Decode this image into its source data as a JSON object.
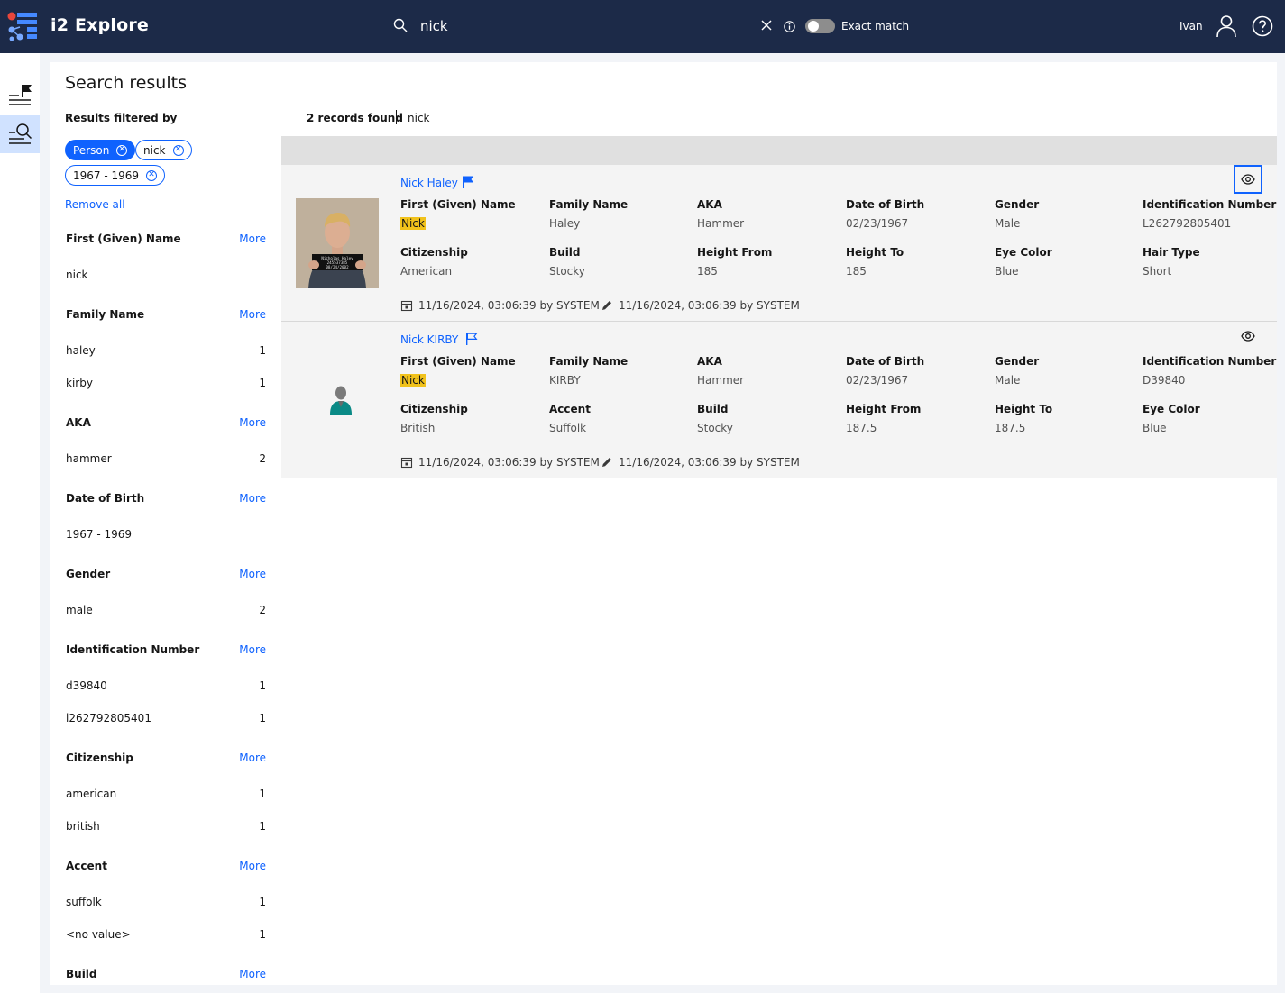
{
  "header": {
    "app_title": "i2 Explore",
    "search_value": "nick",
    "toggle_label": "Exact match",
    "user_name": "Ivan"
  },
  "main": {
    "title": "Search results",
    "records_found": "2 records found",
    "search_term": "nick"
  },
  "filters": {
    "heading": "Results filtered by",
    "chips": [
      "Person",
      "nick",
      "1967 - 1969"
    ],
    "remove_all": "Remove all",
    "more_label": "More",
    "facets": [
      {
        "title": "First (Given) Name",
        "rows": [
          {
            "label": "nick",
            "count": ""
          }
        ]
      },
      {
        "title": "Family Name",
        "rows": [
          {
            "label": "haley",
            "count": "1"
          },
          {
            "label": "kirby",
            "count": "1"
          }
        ]
      },
      {
        "title": "AKA",
        "rows": [
          {
            "label": "hammer",
            "count": "2"
          }
        ]
      },
      {
        "title": "Date of Birth",
        "rows": [
          {
            "label": "1967 - 1969",
            "count": ""
          }
        ]
      },
      {
        "title": "Gender",
        "rows": [
          {
            "label": "male",
            "count": "2"
          }
        ]
      },
      {
        "title": "Identification Number",
        "rows": [
          {
            "label": "d39840",
            "count": "1"
          },
          {
            "label": "l262792805401",
            "count": "1"
          }
        ]
      },
      {
        "title": "Citizenship",
        "rows": [
          {
            "label": "american",
            "count": "1"
          },
          {
            "label": "british",
            "count": "1"
          }
        ]
      },
      {
        "title": "Accent",
        "rows": [
          {
            "label": "suffolk",
            "count": "1"
          },
          {
            "label": "<no value>",
            "count": "1"
          }
        ]
      },
      {
        "title": "Build",
        "rows": []
      }
    ]
  },
  "results": [
    {
      "name": "Nick Haley",
      "flag_filled": true,
      "thumb_caption_1": "Nicholas Haley",
      "thumb_caption_2": "245537385",
      "thumb_caption_3": "08/24/2002",
      "fields": [
        {
          "label": "First (Given) Name",
          "value": "Nick",
          "highlight": true
        },
        {
          "label": "Family Name",
          "value": "Haley"
        },
        {
          "label": "AKA",
          "value": "Hammer"
        },
        {
          "label": "Date of Birth",
          "value": "02/23/1967"
        },
        {
          "label": "Gender",
          "value": "Male"
        },
        {
          "label": "Identification Number",
          "value": "L262792805401"
        },
        {
          "label": "Citizenship",
          "value": "American"
        },
        {
          "label": "Build",
          "value": "Stocky"
        },
        {
          "label": "Height From",
          "value": "185"
        },
        {
          "label": "Height To",
          "value": "185"
        },
        {
          "label": "Eye Color",
          "value": "Blue"
        },
        {
          "label": "Hair Type",
          "value": "Short"
        }
      ],
      "created": "11/16/2024, 03:06:39 by SYSTEM",
      "modified": "11/16/2024, 03:06:39 by SYSTEM"
    },
    {
      "name": "Nick KIRBY",
      "flag_filled": false,
      "fields": [
        {
          "label": "First (Given) Name",
          "value": "Nick",
          "highlight": true
        },
        {
          "label": "Family Name",
          "value": "KIRBY"
        },
        {
          "label": "AKA",
          "value": "Hammer"
        },
        {
          "label": "Date of Birth",
          "value": "02/23/1967"
        },
        {
          "label": "Gender",
          "value": "Male"
        },
        {
          "label": "Identification Number",
          "value": "D39840"
        },
        {
          "label": "Citizenship",
          "value": "British"
        },
        {
          "label": "Accent",
          "value": "Suffolk"
        },
        {
          "label": "Build",
          "value": "Stocky"
        },
        {
          "label": "Height From",
          "value": "187.5"
        },
        {
          "label": "Height To",
          "value": "187.5"
        },
        {
          "label": "Eye Color",
          "value": "Blue"
        }
      ],
      "created": "11/16/2024, 03:06:39 by SYSTEM",
      "modified": "11/16/2024, 03:06:39 by SYSTEM"
    }
  ],
  "colors": {
    "header_bg": "#1c2a48",
    "accent": "#0f62fe",
    "highlight": "#f1c21b",
    "rail_active": "#d0e2ff"
  },
  "icons": {
    "logo": "i2-logo-icon",
    "search": "search-icon",
    "clear": "close-icon",
    "info": "info-icon",
    "user": "user-icon",
    "help": "help-icon",
    "rail_1": "flag-list-icon",
    "rail_2": "search-list-icon",
    "view": "eye-icon",
    "flag": "flag-icon",
    "created": "calendar-icon",
    "modified": "pencil-icon"
  }
}
